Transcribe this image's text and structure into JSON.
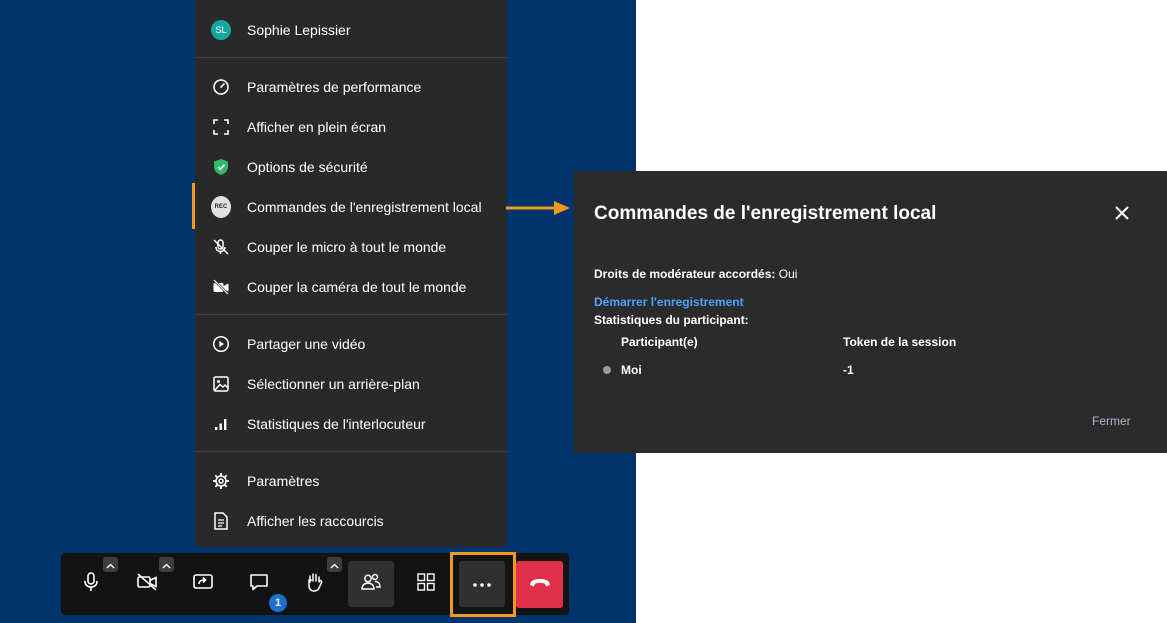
{
  "menu": {
    "user_name": "Sophie Lepissier",
    "user_initials": "SL",
    "items": [
      {
        "label": "Paramètres de performance",
        "icon": "gauge-icon"
      },
      {
        "label": "Afficher en plein écran",
        "icon": "fullscreen-icon"
      },
      {
        "label": "Options de sécurité",
        "icon": "shield-icon"
      },
      {
        "label": "Commandes de l'enregistrement local",
        "icon": "rec-icon",
        "badge": "REC"
      },
      {
        "label": "Couper le micro à tout le monde",
        "icon": "mic-off-icon"
      },
      {
        "label": "Couper la caméra de tout le monde",
        "icon": "camera-off-icon"
      },
      {
        "label": "Partager une vidéo",
        "icon": "play-circle-icon"
      },
      {
        "label": "Sélectionner un arrière-plan",
        "icon": "image-icon"
      },
      {
        "label": "Statistiques de l'interlocuteur",
        "icon": "signal-bars-icon"
      },
      {
        "label": "Paramètres",
        "icon": "gear-icon"
      },
      {
        "label": "Afficher les raccourcis",
        "icon": "document-icon"
      }
    ]
  },
  "dialog": {
    "title": "Commandes de l'enregistrement local",
    "moderator_label": "Droits de modérateur accordés:",
    "moderator_value": "Oui",
    "start_link": "Démarrer l'enregistrement",
    "stats_title": "Statistiques du participant:",
    "columns": [
      "Participant(e)",
      "Token de la session"
    ],
    "rows": [
      {
        "name": "Moi",
        "token": "-1"
      }
    ],
    "close_label": "Fermer"
  },
  "toolbar": {
    "chat_badge": "1",
    "buttons": [
      "microphone-icon",
      "camera-off-icon",
      "screen-share-icon",
      "chat-icon",
      "raise-hand-icon",
      "participants-icon",
      "tile-view-icon",
      "more-icon",
      "hangup-icon"
    ]
  },
  "colors": {
    "stage": "#00346b",
    "menu_bg": "#292929",
    "highlight": "#f29a1b",
    "link": "#4aa3ff",
    "hangup": "#e02f49",
    "avatar": "#17a7a0",
    "shield": "#31b76a"
  }
}
